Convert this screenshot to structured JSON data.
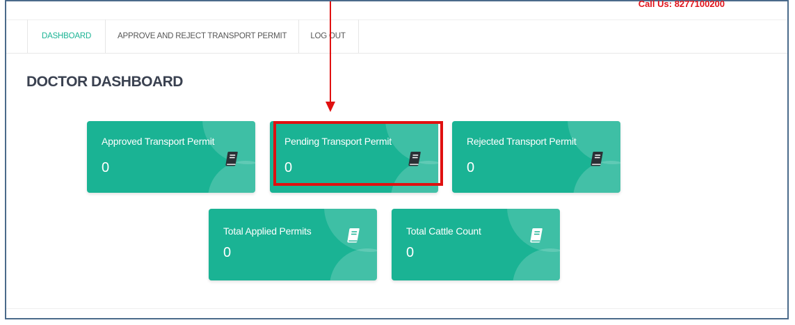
{
  "header": {
    "call_us": "Call Us: 8277100200"
  },
  "nav": {
    "items": [
      {
        "label": "DASHBOARD",
        "active": true
      },
      {
        "label": "APPROVE AND REJECT TRANSPORT PERMIT",
        "active": false
      },
      {
        "label": "LOG OUT",
        "active": false
      }
    ]
  },
  "page": {
    "title": "DOCTOR DASHBOARD"
  },
  "cards": [
    {
      "title": "Approved Transport Permit",
      "value": "0",
      "icon": "book-icon"
    },
    {
      "title": "Pending Transport Permit",
      "value": "0",
      "icon": "book-icon"
    },
    {
      "title": "Rejected Transport Permit",
      "value": "0",
      "icon": "book-icon"
    },
    {
      "title": "Total Applied Permits",
      "value": "0",
      "icon": "book-icon"
    },
    {
      "title": "Total Cattle Count",
      "value": "0",
      "icon": "book-icon"
    }
  ],
  "colors": {
    "accent": "#1ab394",
    "annotation": "#e01010",
    "title_text": "#3a4150"
  }
}
